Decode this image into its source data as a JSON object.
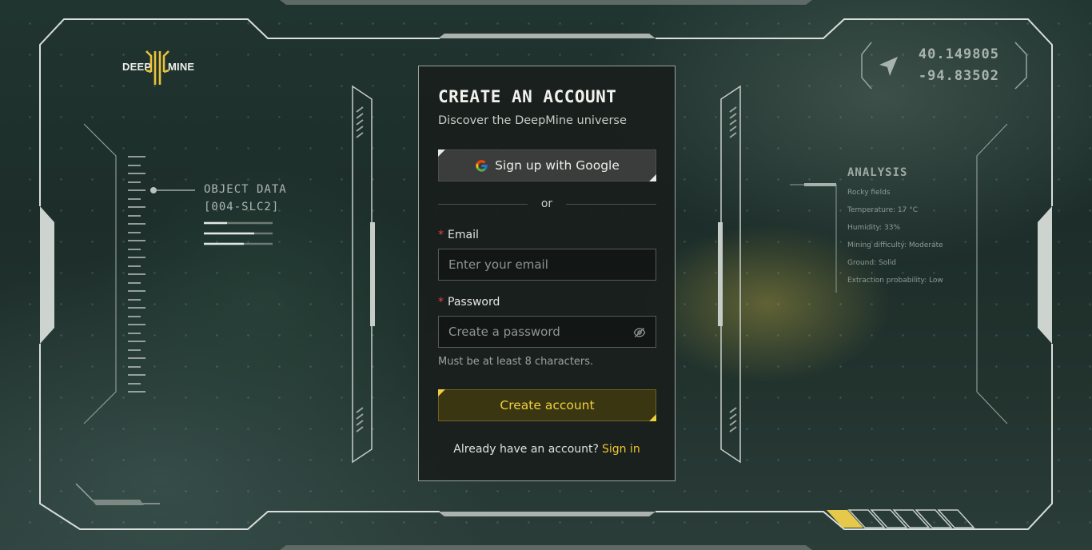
{
  "brand": {
    "left": "DEEP",
    "right": "MINE",
    "accent": "#e9c13a"
  },
  "coordinates": {
    "lat": "40.149805",
    "lon": "-94.83502",
    "icon": "navigation-arrow-icon"
  },
  "object_data": {
    "title": "OBJECT DATA",
    "code": "[004-SLC2]"
  },
  "analysis": {
    "title": "ANALYSIS",
    "items": [
      "Rocky fields",
      "Temperature: 17 °C",
      "Humidity: 33%",
      "Mining difficulty: Moderate",
      "Ground: Solid",
      "Extraction probability: Low"
    ]
  },
  "form": {
    "title": "CREATE AN ACCOUNT",
    "subtitle": "Discover the DeepMine universe",
    "google_button": "Sign up with Google",
    "divider": "or",
    "email": {
      "label": "Email",
      "required_mark": "*",
      "placeholder": "Enter your email",
      "value": ""
    },
    "password": {
      "label": "Password",
      "required_mark": "*",
      "placeholder": "Create a password",
      "value": "",
      "toggle_icon": "eye-off-icon"
    },
    "password_hint": "Must be at least 8 characters.",
    "submit": "Create account",
    "signin_prompt": "Already have an account?",
    "signin_link": "Sign in"
  },
  "colors": {
    "accent": "#f0c72e",
    "required": "#e2443a",
    "frame": "#cfd6d2"
  }
}
